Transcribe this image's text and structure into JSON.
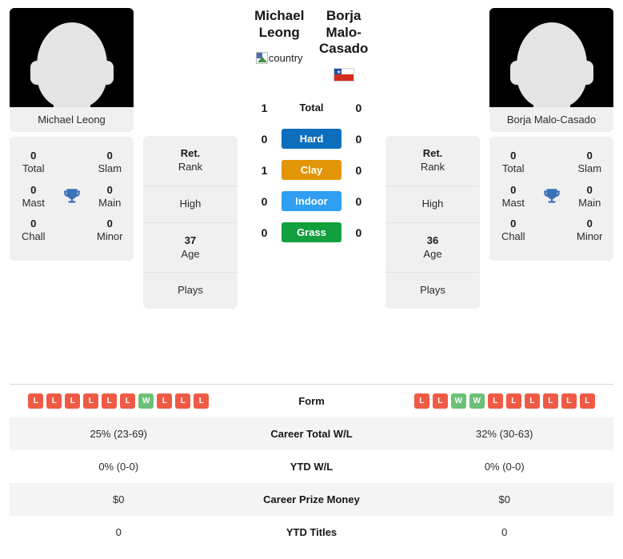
{
  "players": {
    "left": {
      "name_line1": "Michael",
      "name_line2": "Leong",
      "full_name": "Michael Leong",
      "flag_type": "broken-image",
      "flag_alt": "country",
      "photo_alt": "Michael Leong",
      "info": {
        "rank_value": "Ret.",
        "rank_label": "Rank",
        "high_value": "",
        "high_label": "High",
        "age_value": "37",
        "age_label": "Age",
        "plays_value": "",
        "plays_label": "Plays"
      },
      "titles": {
        "total": "0",
        "total_label": "Total",
        "slam": "0",
        "slam_label": "Slam",
        "mast": "0",
        "mast_label": "Mast",
        "main": "0",
        "main_label": "Main",
        "chall": "0",
        "chall_label": "Chall",
        "minor": "0",
        "minor_label": "Minor"
      },
      "form": [
        "L",
        "L",
        "L",
        "L",
        "L",
        "L",
        "W",
        "L",
        "L",
        "L"
      ],
      "career_wl": "25% (23-69)",
      "ytd_wl": "0% (0-0)",
      "prize_money": "$0",
      "ytd_titles": "0"
    },
    "right": {
      "name_line1": "Borja Malo-",
      "name_line2": "Casado",
      "full_name": "Borja Malo-Casado",
      "flag_type": "chile",
      "flag_alt": "Chile",
      "photo_alt": "Borja Malo-Casado",
      "info": {
        "rank_value": "Ret.",
        "rank_label": "Rank",
        "high_value": "",
        "high_label": "High",
        "age_value": "36",
        "age_label": "Age",
        "plays_value": "",
        "plays_label": "Plays"
      },
      "titles": {
        "total": "0",
        "total_label": "Total",
        "slam": "0",
        "slam_label": "Slam",
        "mast": "0",
        "mast_label": "Mast",
        "main": "0",
        "main_label": "Main",
        "chall": "0",
        "chall_label": "Chall",
        "minor": "0",
        "minor_label": "Minor"
      },
      "form": [
        "L",
        "L",
        "W",
        "W",
        "L",
        "L",
        "L",
        "L",
        "L",
        "L"
      ],
      "career_wl": "32% (30-63)",
      "ytd_wl": "0% (0-0)",
      "prize_money": "$0",
      "ytd_titles": "0"
    }
  },
  "h2h": [
    {
      "label": "Total",
      "left": "1",
      "right": "0",
      "color": "",
      "plain": true
    },
    {
      "label": "Hard",
      "left": "0",
      "right": "0",
      "color": "#0d6ebd",
      "plain": false
    },
    {
      "label": "Clay",
      "left": "1",
      "right": "0",
      "color": "#e39508",
      "plain": false
    },
    {
      "label": "Indoor",
      "left": "0",
      "right": "0",
      "color": "#2f9ef3",
      "plain": false
    },
    {
      "label": "Grass",
      "left": "0",
      "right": "0",
      "color": "#12a03e",
      "plain": false
    }
  ],
  "table": [
    {
      "key": "form",
      "label": "Form"
    },
    {
      "key": "career_wl",
      "label": "Career Total W/L"
    },
    {
      "key": "ytd_wl",
      "label": "YTD W/L"
    },
    {
      "key": "prize_money",
      "label": "Career Prize Money"
    },
    {
      "key": "ytd_titles",
      "label": "YTD Titles"
    }
  ],
  "colors": {
    "hard": "#0d6ebd",
    "clay": "#e39508",
    "indoor": "#2f9ef3",
    "grass": "#12a03e",
    "win_badge": "#6cc077",
    "loss_badge": "#ef5a45",
    "card_bg": "#f0f0f0",
    "trophy": "#3a72b8"
  },
  "icons": {
    "trophy": "trophy-icon",
    "broken_image": "broken-image-icon",
    "avatar": "avatar-silhouette-icon"
  }
}
